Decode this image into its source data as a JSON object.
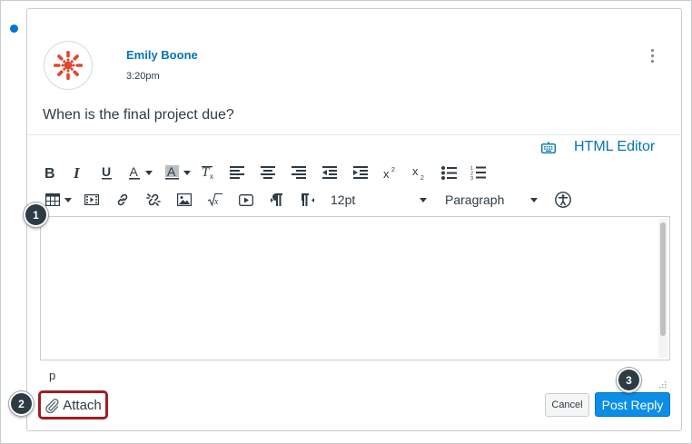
{
  "post": {
    "author": "Emily Boone",
    "time": "3:20pm",
    "message": "When is the final project due?"
  },
  "editor": {
    "html_editor_label": "HTML Editor",
    "font_size": "12pt",
    "block_format": "Paragraph",
    "path": "p",
    "toolbar": {
      "row1": [
        "bold-icon",
        "italic-icon",
        "underline-icon",
        "text-color-icon",
        "background-color-icon",
        "clear-formatting-icon",
        "align-left-icon",
        "align-center-icon",
        "align-right-icon",
        "outdent-icon",
        "indent-icon",
        "superscript-icon",
        "subscript-icon",
        "bulleted-list-icon",
        "numbered-list-icon"
      ],
      "row2": [
        "table-icon",
        "media-icon",
        "link-icon",
        "unlink-icon",
        "image-icon",
        "equation-icon",
        "video-icon",
        "ltr-icon",
        "rtl-icon",
        "accessibility-icon"
      ]
    }
  },
  "actions": {
    "attach_label": "Attach",
    "cancel_label": "Cancel",
    "post_reply_label": "Post Reply"
  },
  "callouts": [
    "1",
    "2",
    "3"
  ],
  "colors": {
    "link_blue": "#0374b5",
    "primary_button": "#0b8ee8",
    "highlight_border": "#a01d26",
    "logo_red": "#e0472e",
    "unread_dot": "#0374d3"
  }
}
